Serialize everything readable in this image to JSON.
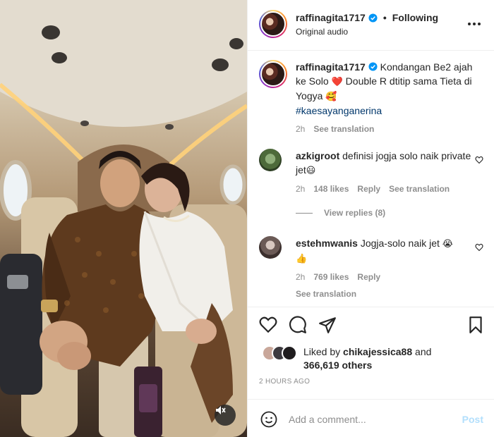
{
  "post": {
    "username": "raffinagita1717",
    "follow_status": "Following",
    "audio": "Original audio",
    "caption_text": "Kondangan Be2 ajah ke Solo",
    "caption_heart": "❤️",
    "caption_text2": "Double R dtitip sama Tieta di Yogya",
    "caption_emoji": "🥰",
    "hashtag": "#kaesayanganerina",
    "caption_time": "2h",
    "see_translation": "See translation"
  },
  "comments": [
    {
      "username": "azkigroot",
      "text": "definisi jogja solo naik private jet",
      "emoji": "😃",
      "time": "2h",
      "likes": "148 likes",
      "reply": "Reply",
      "see_translation": "See translation",
      "view_replies": "View replies (8)"
    },
    {
      "username": "estehmwanis",
      "text": "Jogja-solo naik jet",
      "emoji": "😭",
      "emoji2": "👍",
      "time": "2h",
      "likes": "769 likes",
      "reply": "Reply",
      "see_translation": "See translation"
    }
  ],
  "likes": {
    "prefix": "Liked by",
    "user": "chikajessica88",
    "and": "and",
    "count": "366,619 others"
  },
  "time_ago": "2 HOURS AGO",
  "comment_box": {
    "placeholder": "Add a comment...",
    "post_label": "Post"
  },
  "icons": {
    "more": "more-icon",
    "heart": "heart-icon",
    "comment": "comment-icon",
    "share": "share-icon",
    "save": "bookmark-icon",
    "emoji": "emoji-icon",
    "mute": "muted-speaker-icon",
    "verified": "verified-badge-icon"
  },
  "colors": {
    "verified_blue": "#0095f6",
    "link_blue": "#00376b",
    "post_disabled": "#b2dffc",
    "muted_text": "#8e8e8e"
  }
}
